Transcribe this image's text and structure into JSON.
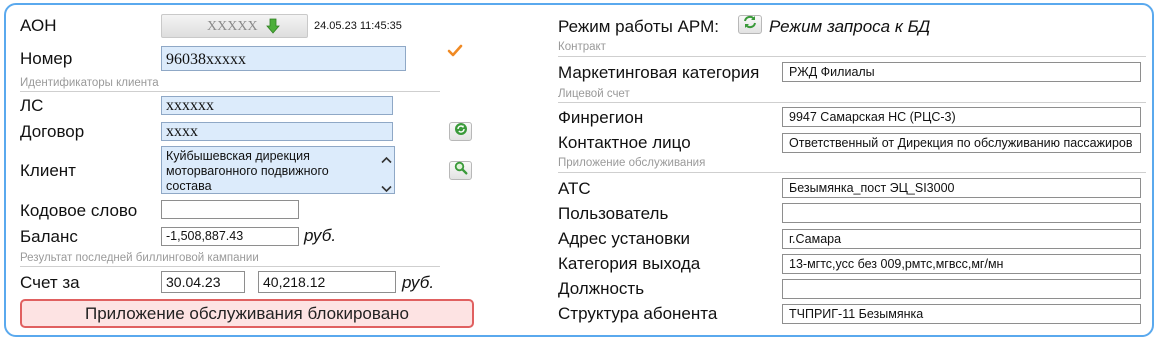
{
  "left": {
    "aon": {
      "label": "АОН",
      "value": "XXXXX",
      "timestamp": "24.05.23 11:45:35"
    },
    "nomer": {
      "label": "Номер",
      "value": "96038xxxxx"
    },
    "section_client_ids": "Идентификаторы клиента",
    "ls": {
      "label": "ЛС",
      "value": "xxxxxx"
    },
    "dogovor": {
      "label": "Договор",
      "value": "xxxx"
    },
    "klient": {
      "label": "Клиент",
      "value": "Куйбышевская  дирекция моторвагонного  подвижного состава"
    },
    "kodovoe_slovo": {
      "label": "Кодовое слово",
      "value": ""
    },
    "balans": {
      "label": "Баланс",
      "value": "-1,508,887.43",
      "unit": "руб."
    },
    "section_billing": "Результат последней биллинговой кампании",
    "schet": {
      "label": "Счет за",
      "date": "30.04.23",
      "amount": "40,218.12",
      "unit": "руб."
    },
    "banner": "Приложение обслуживания блокировано"
  },
  "right": {
    "mode_label": "Режим работы АРМ:",
    "mode_value": "Режим запроса к БД",
    "section_contract": "Контракт",
    "marketing": {
      "label": "Маркетинговая категория",
      "value": "РЖД Филиалы"
    },
    "section_account": "Лицевой счет",
    "finregion": {
      "label": "Финрегион",
      "value": "9947 Самарская НС (РЦС-3)"
    },
    "contact": {
      "label": "Контактное лицо",
      "value": "Ответственный от Дирекция по обслуживанию пассажиров"
    },
    "section_service": "Приложение обслуживания",
    "ats": {
      "label": "АТС",
      "value": "Безымянка_пост ЭЦ_SI3000"
    },
    "user": {
      "label": "Пользователь",
      "value": ""
    },
    "address": {
      "label": "Адрес установки",
      "value": "г.Самара"
    },
    "exit_category": {
      "label": "Категория выхода",
      "value": "13-мгтс,усс без 009,рмтс,мгвсс,мг/мн"
    },
    "position": {
      "label": "Должность",
      "value": ""
    },
    "structure": {
      "label": "Структура абонента",
      "value": "ТЧПРИГ-11 Безымянка"
    }
  },
  "colors": {
    "frame": "#5aa9ee",
    "field_blue": "#dcebfb",
    "banner_bg": "#fde3e3",
    "banner_border": "#e06060",
    "check": "#f08a24",
    "icon_green": "#3a9a3a"
  }
}
